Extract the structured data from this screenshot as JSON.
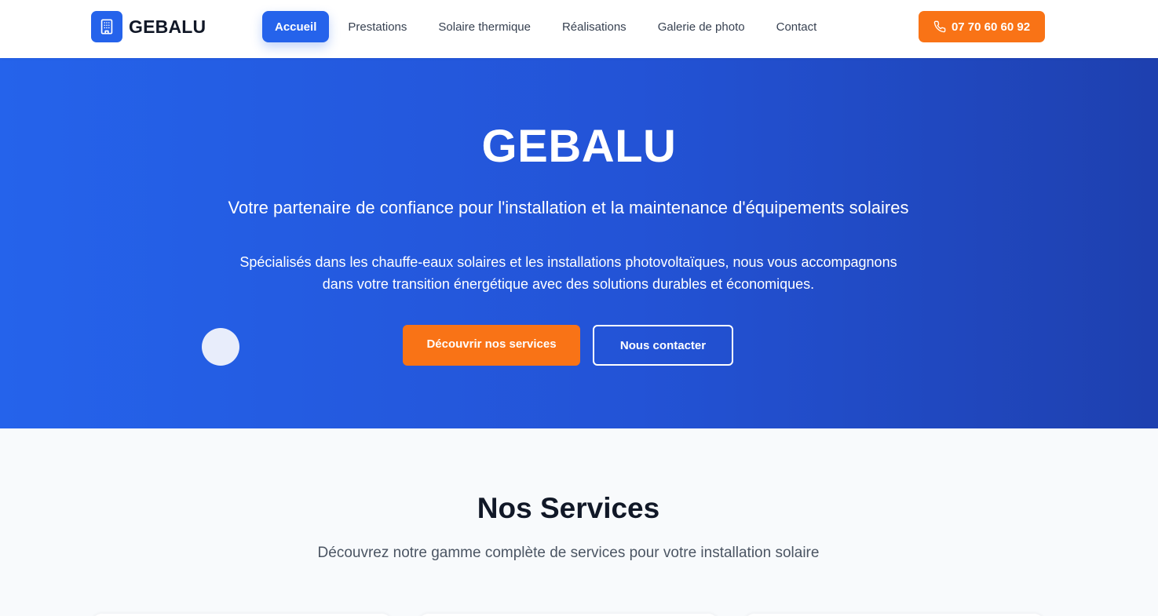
{
  "header": {
    "brand": {
      "name": "GEBALU",
      "icon": "building-icon"
    },
    "nav": [
      {
        "label": "Accueil",
        "active": true
      },
      {
        "label": "Prestations",
        "active": false
      },
      {
        "label": "Solaire thermique",
        "active": false
      },
      {
        "label": "Réalisations",
        "active": false
      },
      {
        "label": "Galerie de photo",
        "active": false
      },
      {
        "label": "Contact",
        "active": false
      }
    ],
    "phone": {
      "number": "07 70 60 60 92",
      "icon": "phone-icon"
    }
  },
  "hero": {
    "title": "GEBALU",
    "subtitle": "Votre partenaire de confiance pour l'installation et la maintenance d'équipements solaires",
    "description": "Spécialisés dans les chauffe-eaux solaires et les installations photovoltaïques, nous vous accompagnons dans votre transition énergétique avec des solutions durables et économiques.",
    "primary_button": "Découvrir nos services",
    "secondary_button": "Nous contacter"
  },
  "services": {
    "title": "Nos Services",
    "subtitle": "Découvrez notre gamme complète de services pour votre installation solaire"
  },
  "colors": {
    "brand_blue": "#2563eb",
    "hero_gradient_start": "#2563eb",
    "hero_gradient_end": "#1e40af",
    "accent_orange": "#f97316",
    "heading_text": "#111827",
    "nav_text": "#374151",
    "muted_text": "#4b5563",
    "section_background": "#f8fafc"
  }
}
